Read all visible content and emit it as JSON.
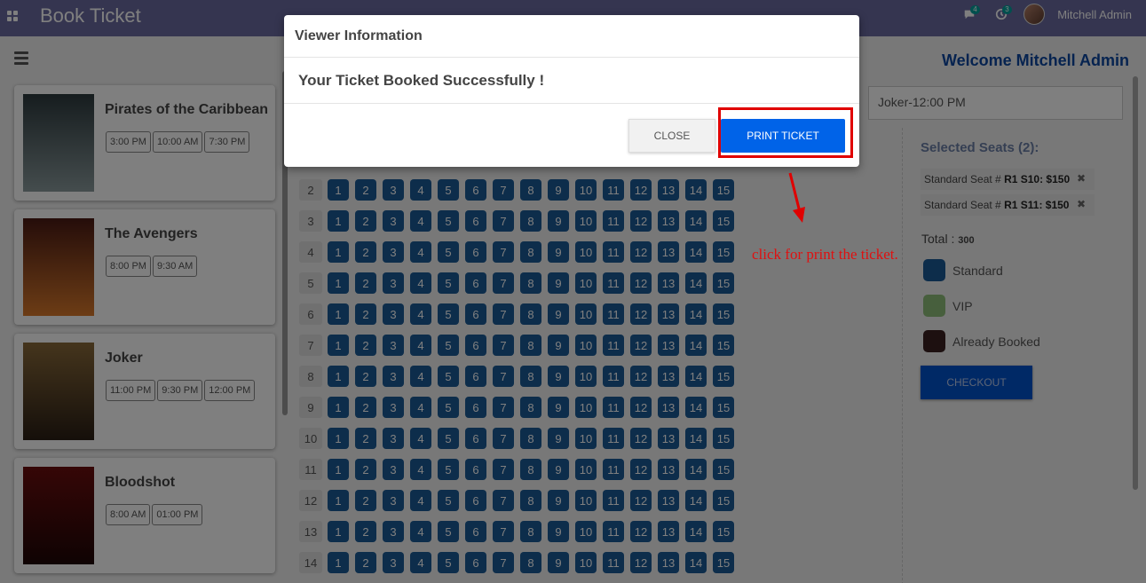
{
  "app": {
    "title": "Book Ticket"
  },
  "nav": {
    "messages_count": "4",
    "activity_count": "3",
    "user_name": "Mitchell Admin"
  },
  "movies": [
    {
      "title": "Pirates of the Caribbean",
      "poster_colors": [
        "#2d3a3e",
        "#8a9a9c"
      ],
      "shows": [
        "3:00 PM",
        "10:00 AM",
        "7:30 PM"
      ]
    },
    {
      "title": "The Avengers",
      "poster_colors": [
        "#4a1a14",
        "#d9792b"
      ],
      "shows": [
        "8:00 PM",
        "9:30 AM"
      ]
    },
    {
      "title": "Joker",
      "poster_colors": [
        "#8a6a3a",
        "#2a1e14"
      ],
      "shows": [
        "11:00 PM",
        "9:30 PM",
        "12:00 PM"
      ]
    },
    {
      "title": "Bloodshot",
      "poster_colors": [
        "#6b0e0e",
        "#1e0606"
      ],
      "shows": [
        "8:00 AM",
        "01:00 PM"
      ]
    }
  ],
  "seats": {
    "row_labels": [
      "2",
      "3",
      "4",
      "5",
      "6",
      "7",
      "8",
      "9",
      "10",
      "11",
      "12",
      "13",
      "14"
    ],
    "seat_numbers": [
      "1",
      "2",
      "3",
      "4",
      "5",
      "6",
      "7",
      "8",
      "9",
      "10",
      "11",
      "12",
      "13",
      "14",
      "15"
    ]
  },
  "right_panel": {
    "welcome": "Welcome Mitchell Admin",
    "selected_show": "Joker-12:00 PM",
    "selected_title": "Selected Seats (2):",
    "chips": [
      {
        "prefix": "Standard Seat # ",
        "seat": "R1 S10: $150",
        "remove": "✖"
      },
      {
        "prefix": "Standard Seat # ",
        "seat": "R1 S11: $150",
        "remove": "✖"
      }
    ],
    "total_label": "Total :",
    "total_value": "300",
    "legend": [
      {
        "label": "Standard",
        "color": "#1a5a96"
      },
      {
        "label": "VIP",
        "color": "#8fbf7a"
      },
      {
        "label": "Already Booked",
        "color": "#3a2020"
      }
    ],
    "checkout_label": "CHECKOUT"
  },
  "modal": {
    "title": "Viewer Information",
    "message": "Your Ticket Booked Successfully !",
    "close_label": "CLOSE",
    "print_label": "PRINT TICKET"
  },
  "annotation": {
    "text": "click for print the ticket."
  },
  "colors": {
    "navbar": "#6b6aa0",
    "primary": "#0063e8",
    "highlight": "#e00000"
  }
}
